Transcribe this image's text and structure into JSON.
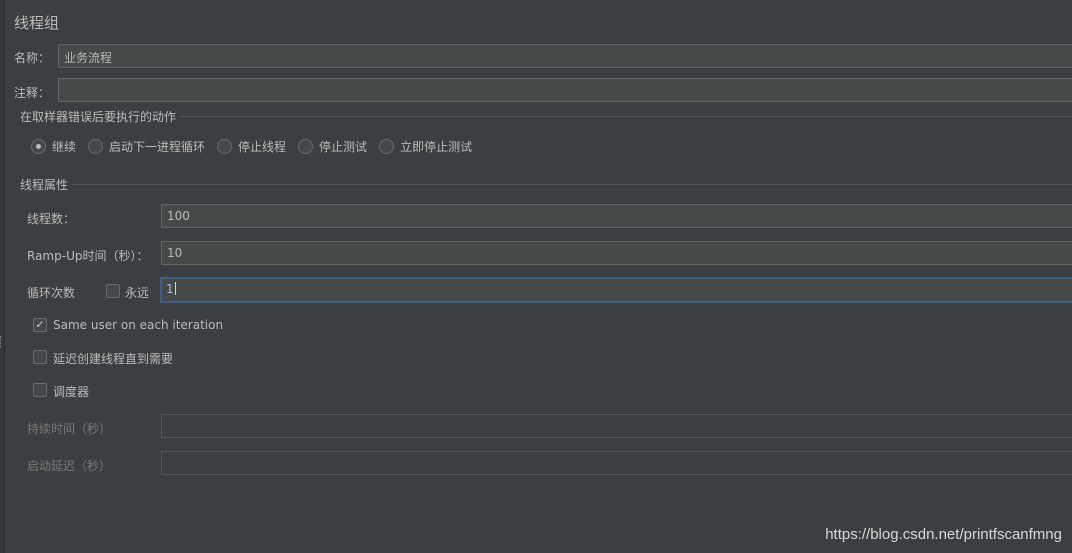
{
  "panel": {
    "title": "线程组"
  },
  "name": {
    "label": "名称：",
    "value": "业务流程"
  },
  "comment": {
    "label": "注释：",
    "value": ""
  },
  "error_action": {
    "title": "在取样器错误后要执行的动作",
    "options": [
      "继续",
      "启动下一进程循环",
      "停止线程",
      "停止测试",
      "立即停止测试"
    ],
    "selected": "继续"
  },
  "thread_props": {
    "title": "线程属性",
    "num_threads": {
      "label": "线程数：",
      "value": "100"
    },
    "ramp_up": {
      "label": "Ramp-Up时间（秒）：",
      "value": "10"
    },
    "loop": {
      "label": "循环次数",
      "forever_label": "永远",
      "forever_checked": false,
      "value": "1"
    },
    "same_user": {
      "label": "Same user on each iteration",
      "checked": true
    },
    "delay_create": {
      "label": "延迟创建线程直到需要",
      "checked": false
    },
    "scheduler": {
      "label": "调度器",
      "checked": false
    },
    "duration": {
      "label": "持续时间（秒）",
      "value": ""
    },
    "startup_delay": {
      "label": "启动延迟（秒）",
      "value": ""
    }
  },
  "watermark": "https://blog.csdn.net/printfscanfmng",
  "icons": {
    "check": "✓"
  },
  "colors": {
    "background": "#3c3f41",
    "focus_border": "#3d6185",
    "field_bg": "#45494a"
  }
}
